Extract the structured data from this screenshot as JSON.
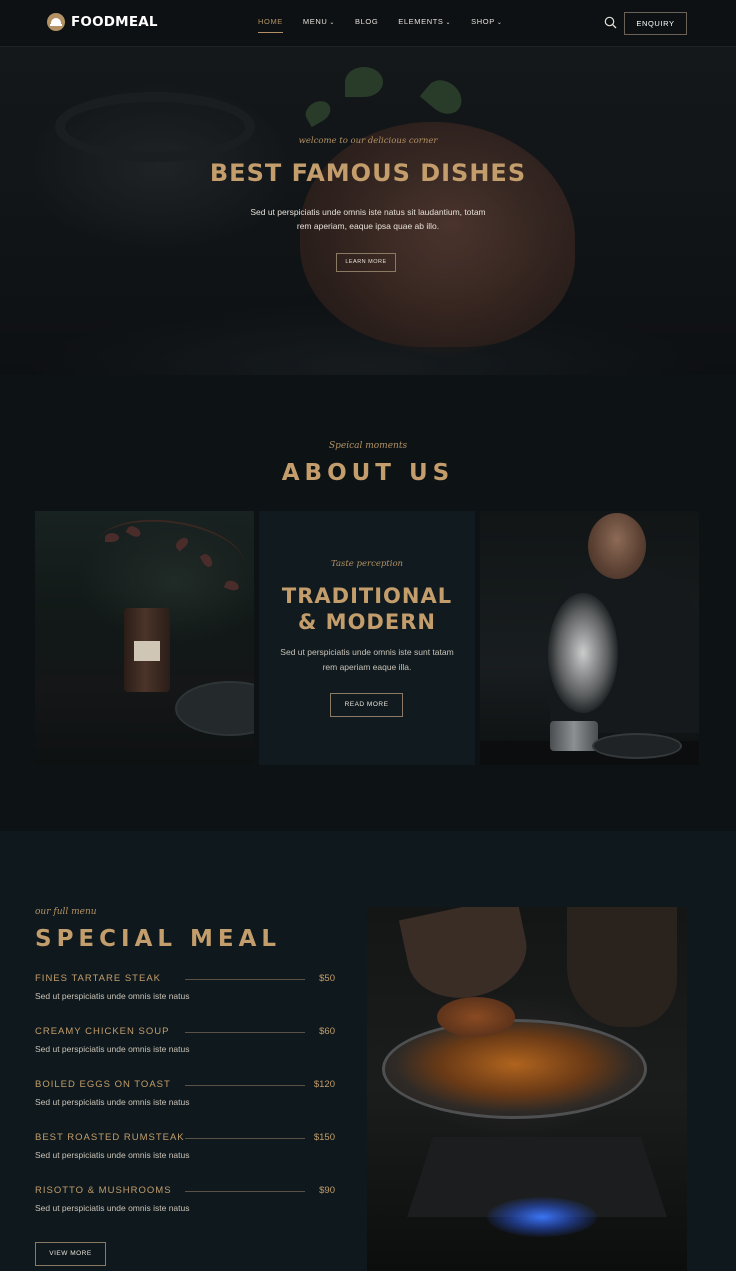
{
  "header": {
    "logo_text": "FOODMEAL",
    "nav": [
      {
        "label": "HOME",
        "active": true,
        "has_dropdown": false
      },
      {
        "label": "MENU",
        "active": false,
        "has_dropdown": true
      },
      {
        "label": "BLOG",
        "active": false,
        "has_dropdown": false
      },
      {
        "label": "ELEMENTS",
        "active": false,
        "has_dropdown": true
      },
      {
        "label": "SHOP",
        "active": false,
        "has_dropdown": true
      }
    ],
    "search_icon": "search-icon",
    "enquiry_label": "ENQUIRY"
  },
  "hero": {
    "kicker": "welcome to our delicious corner",
    "title": "BEST FAMOUS DISHES",
    "text": "Sed ut perspiciatis unde omnis iste natus sit laudantium, totam rem aperiam, eaque ipsa quae ab illo.",
    "button_label": "LEARN MORE"
  },
  "about": {
    "kicker": "Speical moments",
    "title": "ABOUT US",
    "card": {
      "kicker": "Taste perception",
      "title_line1": "TRADITIONAL",
      "title_line2": "& MODERN",
      "text": "Sed ut perspiciatis unde omnis iste sunt tatam rem aperiam eaque illa.",
      "button_label": "READ MORE"
    }
  },
  "special_meal": {
    "kicker": "our full menu",
    "title": "SPECIAL MEAL",
    "items": [
      {
        "name": "FINES TARTARE STEAK",
        "price": "$50",
        "desc": "Sed ut perspiciatis unde omnis iste natus"
      },
      {
        "name": "CREAMY CHICKEN SOUP",
        "price": "$60",
        "desc": "Sed ut perspiciatis unde omnis iste natus"
      },
      {
        "name": "BOILED EGGS ON TOAST",
        "price": "$120",
        "desc": "Sed ut perspiciatis unde omnis iste natus"
      },
      {
        "name": "BEST ROASTED RUMSTEAK",
        "price": "$150",
        "desc": "Sed ut perspiciatis unde omnis iste natus"
      },
      {
        "name": "RISOTTO & MUSHROOMS",
        "price": "$90",
        "desc": "Sed ut perspiciatis unde omnis iste natus"
      }
    ],
    "button_label": "VIEW MORE"
  },
  "colors": {
    "accent_gold": "#c39d6b",
    "background_dark": "#0f1416",
    "panel": "#111b1f"
  }
}
